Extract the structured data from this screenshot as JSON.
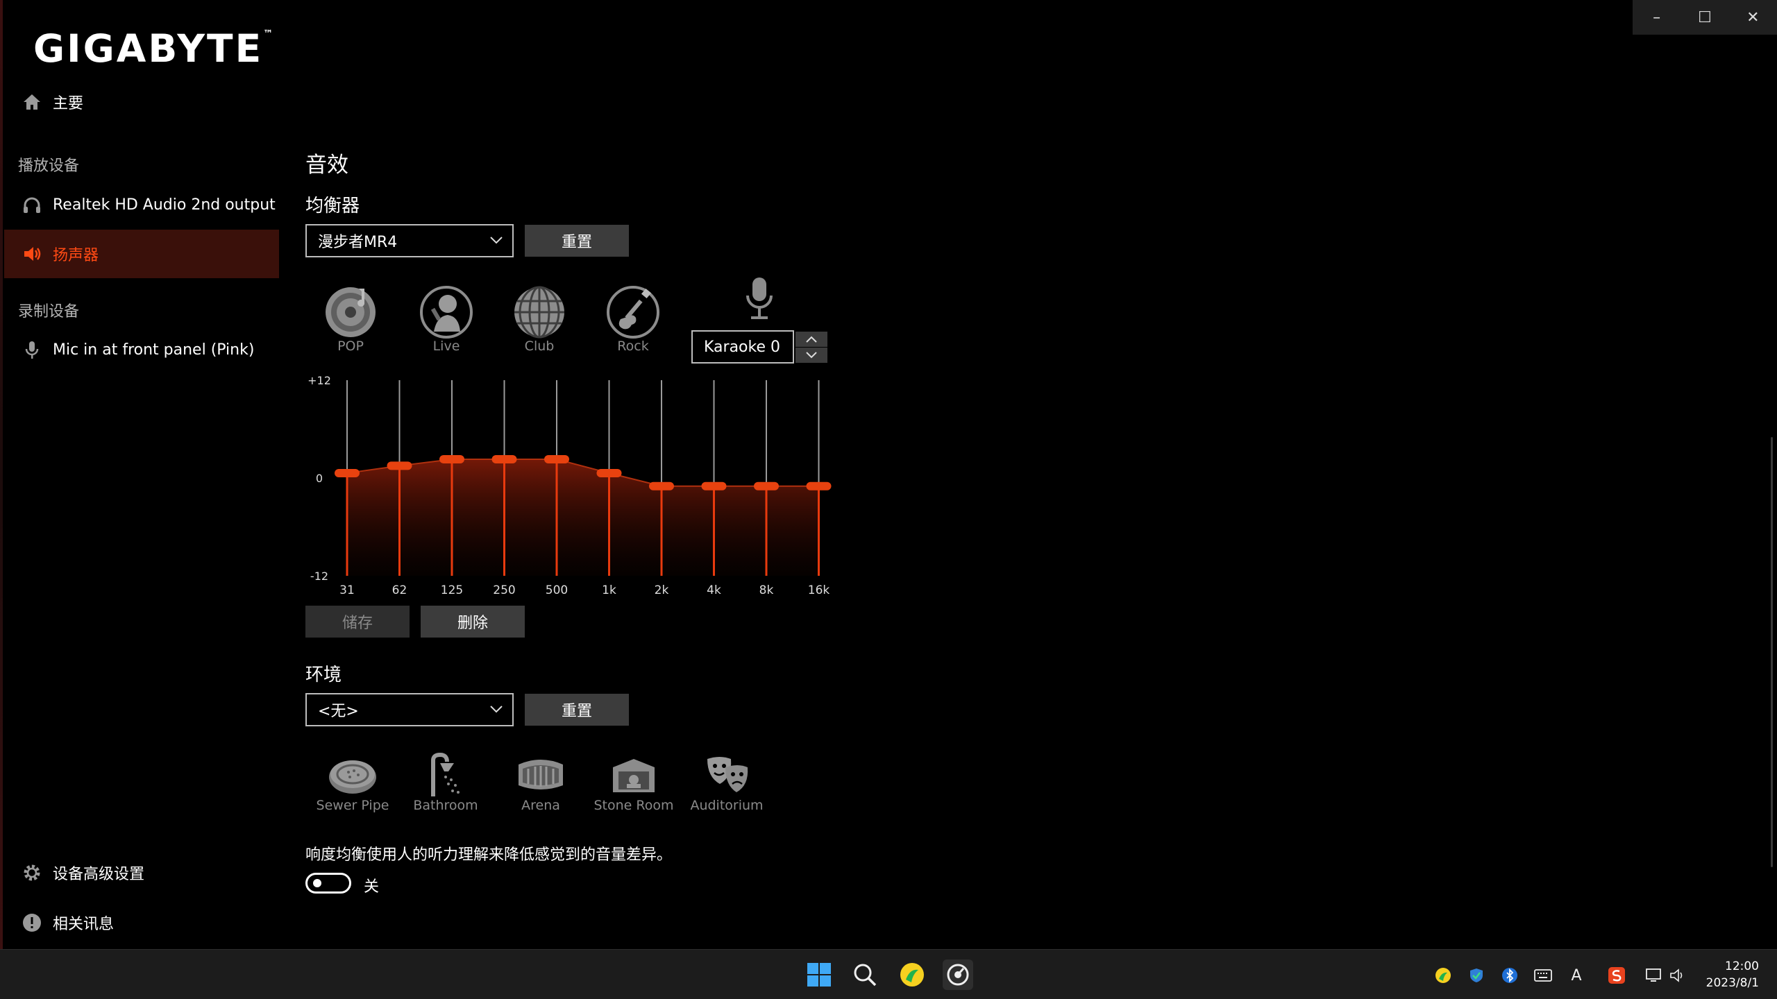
{
  "window": {
    "brand": "GIGABYTE",
    "trademark": "™",
    "controls": {
      "minimize": "–",
      "maximize": "☐",
      "close": "✕"
    }
  },
  "sidebar": {
    "home": "主要",
    "playback_section": "播放设备",
    "playback_devices": [
      "Realtek HD Audio 2nd output",
      "扬声器"
    ],
    "recording_section": "录制设备",
    "recording_devices": [
      "Mic in at front panel (Pink)"
    ],
    "advanced_settings": "设备高级设置",
    "about": "相关讯息",
    "active_color": "#ff4a14"
  },
  "main": {
    "title": "音效",
    "equalizer": {
      "label": "均衡器",
      "selected": "漫步者MR4",
      "reset": "重置",
      "presets": [
        "POP",
        "Live",
        "Club",
        "Rock"
      ],
      "karaoke": "Karaoke 0",
      "save": "储存",
      "delete": "删除"
    },
    "environment": {
      "label": "环境",
      "selected": "<无>",
      "reset": "重置",
      "presets": [
        "Sewer Pipe",
        "Bathroom",
        "Arena",
        "Stone Room",
        "Auditorium"
      ]
    },
    "loudness": {
      "description": "响度均衡使用人的听力理解来降低感觉到的音量差异。",
      "state": "关",
      "enabled": false
    }
  },
  "chart_data": {
    "type": "line",
    "categories": [
      "31",
      "62",
      "125",
      "250",
      "500",
      "1k",
      "2k",
      "4k",
      "8k",
      "16k"
    ],
    "values": [
      0.6,
      1.5,
      2.3,
      2.3,
      2.3,
      0.6,
      -1.0,
      -1.0,
      -1.0,
      -1.0
    ],
    "ylim": [
      -12,
      12
    ],
    "y_tick_labels": [
      "+12",
      "0",
      "-12"
    ],
    "accent": "#e83a0e"
  },
  "taskbar": {
    "time": "12:00",
    "date": "2023/8/1",
    "ime": "A"
  }
}
